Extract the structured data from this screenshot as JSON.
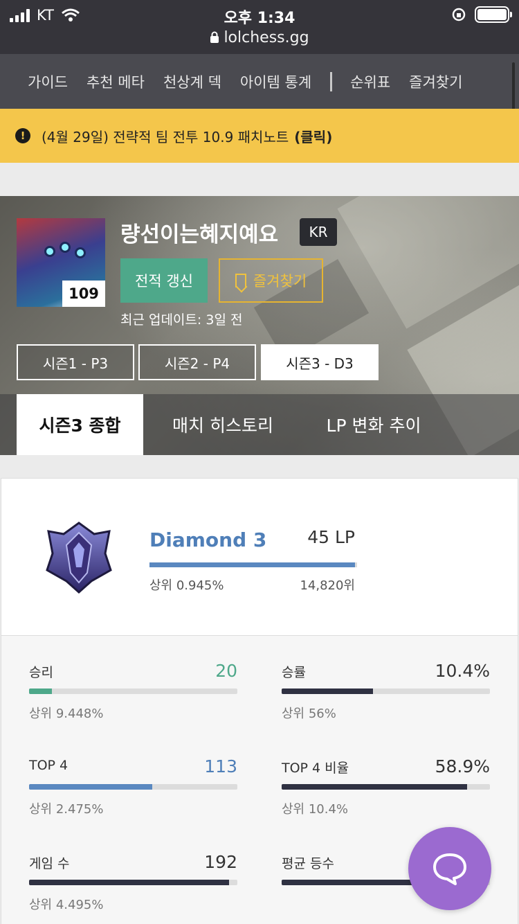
{
  "status_bar": {
    "carrier": "KT",
    "time": "오후 1:34",
    "url": "lolchess.gg"
  },
  "nav": {
    "items": [
      "가이드",
      "추천 메타",
      "천상계 덱",
      "아이템 통계"
    ],
    "items_right": [
      "순위표",
      "즐겨찾기"
    ]
  },
  "notice": {
    "text": "(4월 29일) 전략적 팀 전투 10.9 패치노트",
    "link": "(클릭)"
  },
  "profile": {
    "name": "량선이는혜지예요",
    "region": "KR",
    "level": "109",
    "refresh_label": "전적 갱신",
    "favorite_label": "즐겨찾기",
    "last_updated": "최근 업데이트: 3일 전",
    "seasons": [
      "시즌1 - P3",
      "시즌2 - P4",
      "시즌3 - D3"
    ],
    "active_season": 2,
    "tabs": [
      "시즌3 종합",
      "매치 히스토리",
      "LP 변화 추이"
    ],
    "active_tab": 0
  },
  "rank": {
    "tier": "Diamond 3",
    "lp": "45 LP",
    "percentile": "상위 0.945%",
    "position": "14,820위",
    "progress": 0.99,
    "colors": {
      "tier": "#4f7fb8",
      "bar": "#5a88c0"
    }
  },
  "stats": [
    {
      "label": "승리",
      "value": "20",
      "rank": "상위 9.448%",
      "progress": 0.11,
      "value_color": "#4ea88a",
      "bar_color": "#4ea88a"
    },
    {
      "label": "승률",
      "value": "10.4%",
      "rank": "상위 56%",
      "progress": 0.44,
      "value_color": "#333333",
      "bar_color": "#2f3142"
    },
    {
      "label": "TOP 4",
      "value": "113",
      "rank": "상위 2.475%",
      "progress": 0.59,
      "value_color": "#4f7fb8",
      "bar_color": "#5a88c0"
    },
    {
      "label": "TOP 4 비율",
      "value": "58.9%",
      "rank": "상위 10.4%",
      "progress": 0.89,
      "value_color": "#333333",
      "bar_color": "#2f3142"
    },
    {
      "label": "게임 수",
      "value": "192",
      "rank": "상위 4.495%",
      "progress": 0.96,
      "value_color": "#333333",
      "bar_color": "#2f3142"
    },
    {
      "label": "평균 등수",
      "value": "",
      "rank": "",
      "progress": 0.9,
      "value_color": "#333333",
      "bar_color": "#2f3142"
    }
  ],
  "icons": {
    "alert": "alert-circle-icon",
    "bookmark": "bookmark-icon",
    "chat": "chat-bubble-icon",
    "lock": "lock-icon",
    "wifi": "wifi-icon",
    "battery": "battery-icon"
  }
}
